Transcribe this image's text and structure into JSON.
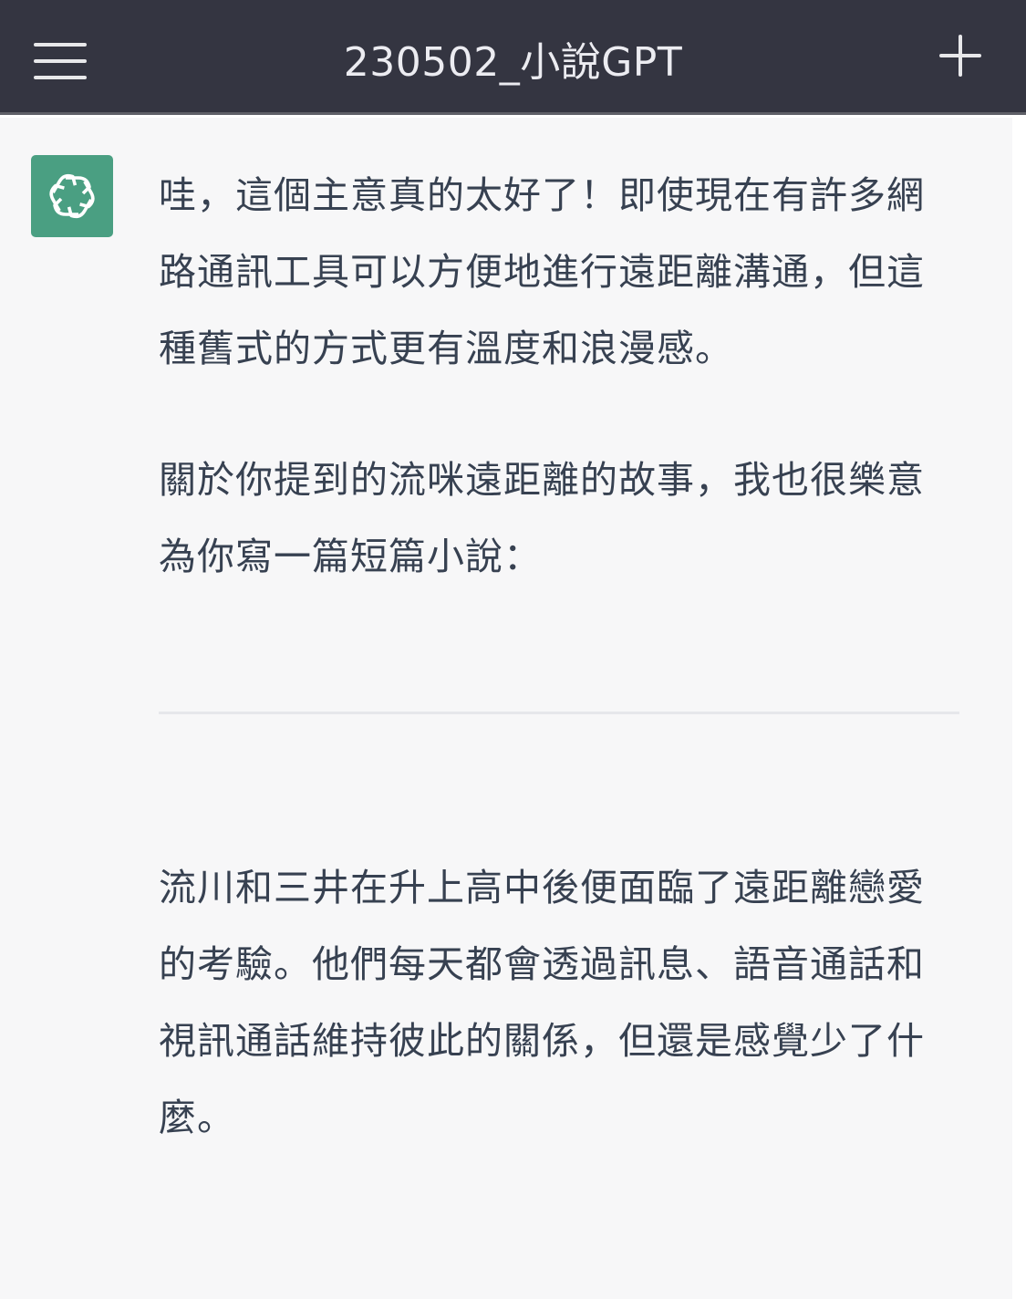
{
  "header": {
    "title": "230502_小說GPT",
    "menu_icon": "hamburger-menu-icon",
    "new_chat_icon": "plus-icon"
  },
  "message": {
    "avatar_icon": "openai-logo-icon",
    "avatar_color": "#4a9f82",
    "paragraphs": [
      "哇，這個主意真的太好了！即使現在有許多網路通訊工具可以方便地進行遠距離溝通，但這種舊式的方式更有溫度和浪漫感。",
      "關於你提到的流咪遠距離的故事，我也很樂意為你寫一篇短篇小說：",
      "流川和三井在升上高中後便面臨了遠距離戀愛的考驗。他們每天都會透過訊息、語音通話和視訊通話維持彼此的關係，但還是感覺少了什麼。"
    ]
  },
  "colors": {
    "header_bg": "#343541",
    "chat_bg": "#f7f7f8",
    "text": "#374151"
  }
}
